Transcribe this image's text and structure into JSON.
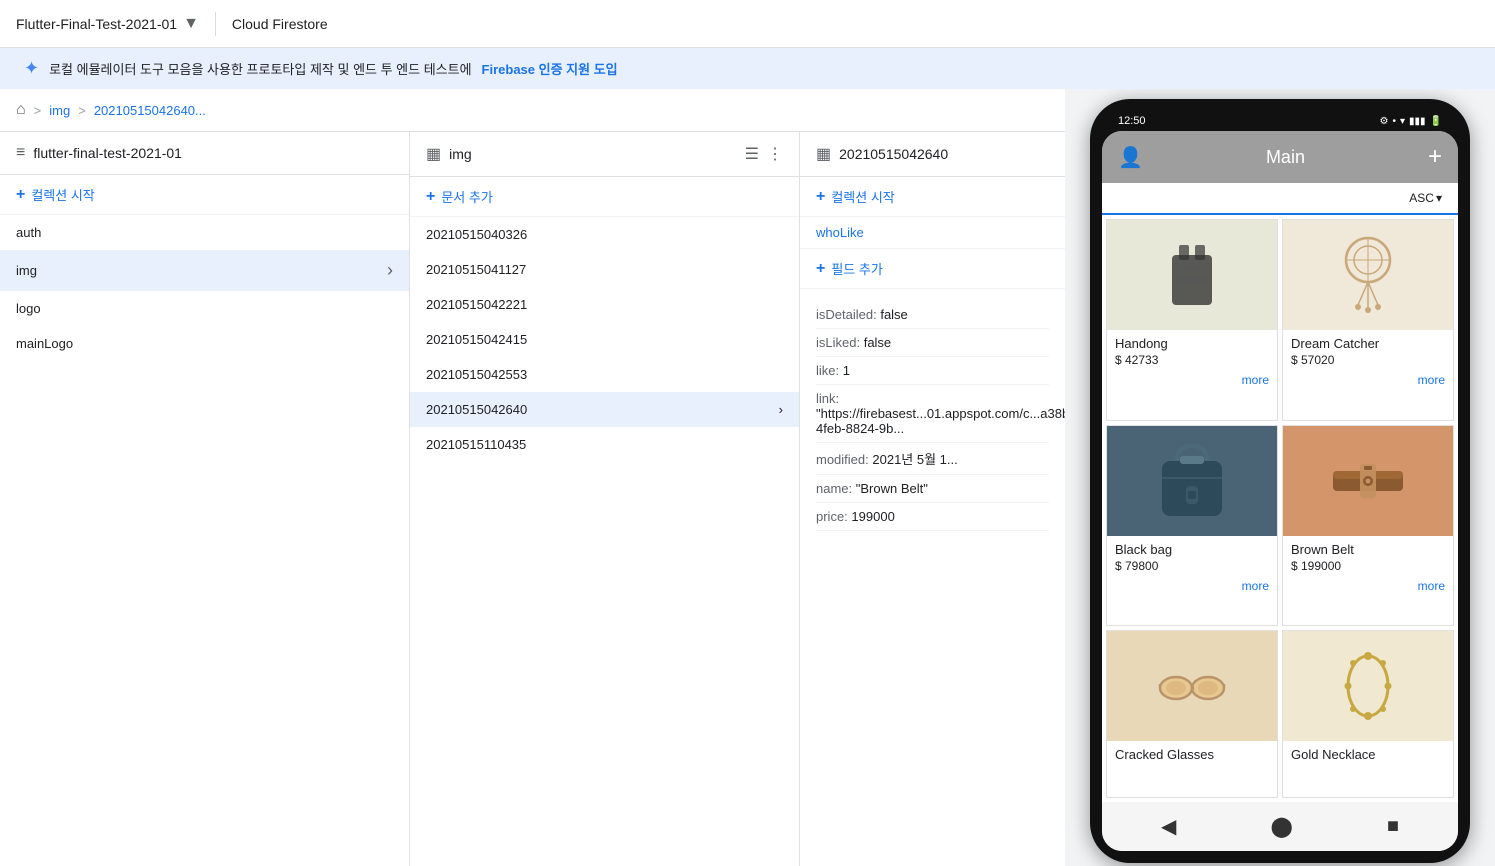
{
  "topbar": {
    "project": "Flutter-Final-Test-2021-01",
    "chevron": "▼",
    "service": "Cloud Firestore"
  },
  "banner": {
    "text": "로컬 에뮬레이터 도구 모음을 사용한 프로토타입 제작 및 엔드 투 엔드 테스트에",
    "highlight": " Firebase 인증 지원 도입",
    "sparkle": "✦"
  },
  "breadcrumb": {
    "home": "⌂",
    "sep1": ">",
    "link1": "img",
    "sep2": ">",
    "link2": "20210515042640..."
  },
  "sidebar": {
    "title": "flutter-final-test-2021-01",
    "icon": "≡",
    "add_label": "컬렉션 시작",
    "items": [
      {
        "id": "auth",
        "label": "auth",
        "selected": false
      },
      {
        "id": "img",
        "label": "img",
        "selected": true
      },
      {
        "id": "logo",
        "label": "logo",
        "selected": false
      },
      {
        "id": "mainLogo",
        "label": "mainLogo",
        "selected": false
      }
    ]
  },
  "docs_col": {
    "title": "img",
    "add_label": "문서 추가",
    "items": [
      {
        "id": "20210515040326",
        "label": "20210515040326",
        "selected": false
      },
      {
        "id": "20210515041127",
        "label": "20210515041127",
        "selected": false
      },
      {
        "id": "20210515042221",
        "label": "20210515042221",
        "selected": false
      },
      {
        "id": "20210515042415",
        "label": "20210515042415",
        "selected": false
      },
      {
        "id": "20210515042553",
        "label": "20210515042553",
        "selected": false
      },
      {
        "id": "20210515042640",
        "label": "20210515042640",
        "selected": true
      },
      {
        "id": "20210515110435",
        "label": "20210515110435",
        "selected": false
      }
    ]
  },
  "detail_col": {
    "doc_id": "20210515042640",
    "add_collection_label": "컬렉션 시작",
    "fields": [
      {
        "key": "whoLike",
        "value": ""
      },
      {
        "key": "isDetailed:",
        "value": "false"
      },
      {
        "key": "isLiked:",
        "value": "false"
      },
      {
        "key": "like:",
        "value": "1"
      },
      {
        "key": "link:",
        "value": "\"https://firebasest...01.appspot.com/c...a38b-4feb-8824-9b..."
      },
      {
        "key": "modified:",
        "value": "2021년 5월 1..."
      },
      {
        "key": "name:",
        "value": "\"Brown Belt\""
      },
      {
        "key": "price:",
        "value": "199000"
      }
    ],
    "add_field_label": "필드 추가"
  },
  "phone": {
    "status": {
      "time": "12:50",
      "icons": "▾▾▮"
    },
    "appbar": {
      "title": "Main",
      "person_icon": "👤",
      "add_icon": "+"
    },
    "sort": {
      "label": "ASC",
      "arrow": "▾"
    },
    "products": [
      {
        "id": "handong",
        "name": "Handong",
        "price": "$ 42733",
        "more": "more",
        "emoji": "🪆",
        "bg": "#f5f5f0"
      },
      {
        "id": "dream-catcher",
        "name": "Dream Catcher",
        "price": "$ 57020",
        "more": "more",
        "emoji": "🧿",
        "bg": "#f5f0e8"
      },
      {
        "id": "black-bag",
        "name": "Black bag",
        "price": "$ 79800",
        "more": "more",
        "emoji": "🎒",
        "bg": "#3d5a6e"
      },
      {
        "id": "brown-belt",
        "name": "Brown Belt",
        "price": "$ 199000",
        "more": "more",
        "emoji": "👜",
        "bg": "#c47a45"
      },
      {
        "id": "cracked-glasses",
        "name": "Cracked Glasses",
        "price": "",
        "more": "",
        "emoji": "👓",
        "bg": "#e8d5b5"
      },
      {
        "id": "gold-necklace",
        "name": "Gold Necklace",
        "price": "",
        "more": "",
        "emoji": "📿",
        "bg": "#f0e8d0"
      }
    ],
    "nav": {
      "back": "◀",
      "home": "⬤",
      "square": "■"
    }
  }
}
